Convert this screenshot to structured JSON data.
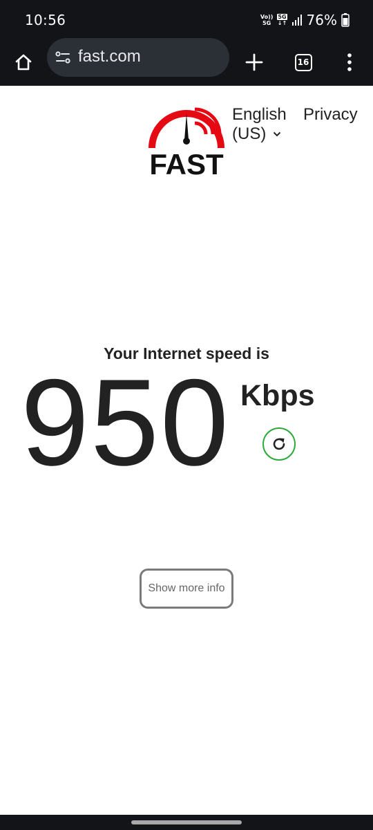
{
  "status_bar": {
    "time": "10:56",
    "volte_line1": "Vo))",
    "volte_line2": "5G",
    "network_badge": "5G",
    "battery_percent": "76%"
  },
  "browser": {
    "url": "fast.com",
    "tab_count": "16",
    "icons": [
      "home-icon",
      "site-settings-icon",
      "new-tab-icon",
      "tab-switcher-icon",
      "more-options-icon"
    ]
  },
  "page": {
    "logo_text": "FAST",
    "language_line1": "English",
    "language_line2": "(US)",
    "privacy_label": "Privacy",
    "caption": "Your Internet speed is",
    "speed_value": "950",
    "speed_units": "Kbps",
    "more_info_label": "Show more info"
  },
  "colors": {
    "brand_red": "#e50914",
    "reload_green": "#2fa83a",
    "toolbar_bg": "#121418"
  }
}
